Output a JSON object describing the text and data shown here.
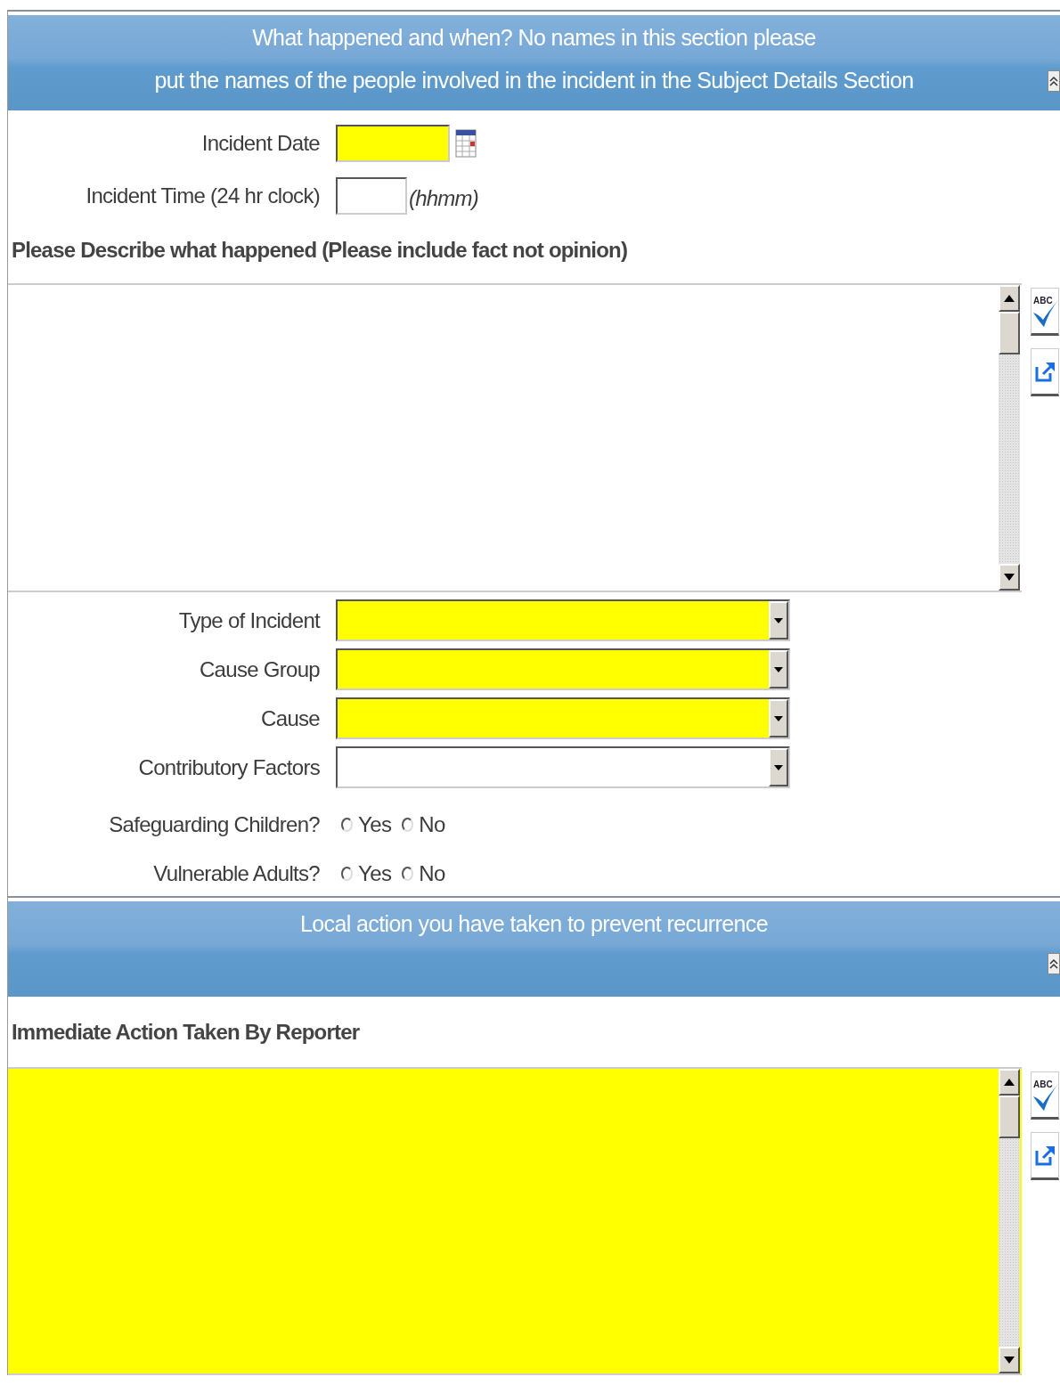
{
  "sections": [
    {
      "title_lines": [
        "What happened and when? No names in this section please",
        "put the names of the people involved in the incident in the Subject Details Section"
      ],
      "items": [
        {
          "kind": "date",
          "label": "Incident Date",
          "required": true
        },
        {
          "kind": "time",
          "label": "Incident Time (24 hr clock)",
          "hint": "(hhmm)",
          "required": false
        },
        {
          "kind": "heading",
          "label": "Please Describe what happened (Please include fact not opinion)"
        },
        {
          "kind": "textarea",
          "required": false,
          "spell_text": "ABC"
        },
        {
          "kind": "select",
          "label": "Type of Incident",
          "required": true
        },
        {
          "kind": "select",
          "label": "Cause Group",
          "required": true
        },
        {
          "kind": "select",
          "label": "Cause",
          "required": true
        },
        {
          "kind": "select",
          "label": "Contributory Factors",
          "required": false
        },
        {
          "kind": "radio",
          "label": "Safeguarding Children?",
          "options": [
            {
              "label": "Yes",
              "selected": false
            },
            {
              "label": "No",
              "selected": false
            }
          ]
        },
        {
          "kind": "radio",
          "label": "Vulnerable Adults?",
          "options": [
            {
              "label": "Yes",
              "selected": false
            },
            {
              "label": "No",
              "selected": false
            }
          ]
        }
      ]
    },
    {
      "title_lines": [
        "Local action you have taken to prevent recurrence"
      ],
      "items": [
        {
          "kind": "heading",
          "label": "Immediate Action Taken By Reporter"
        },
        {
          "kind": "textarea",
          "required": true,
          "spell_text": "ABC"
        }
      ]
    }
  ]
}
